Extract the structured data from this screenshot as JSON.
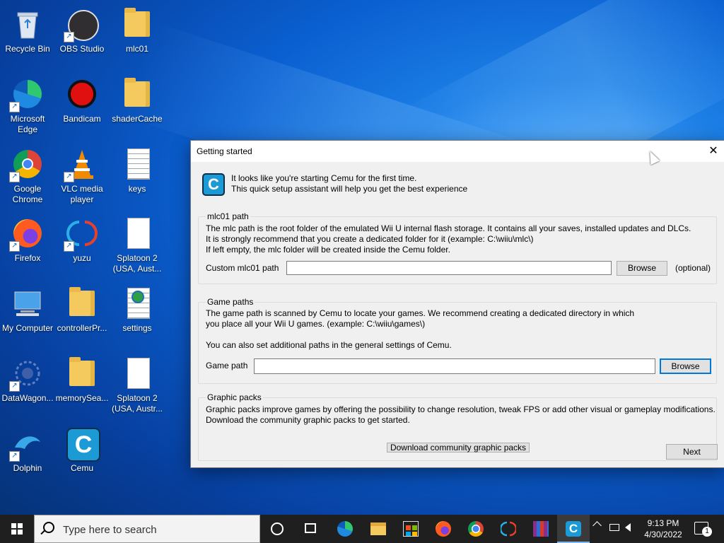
{
  "desktop": {
    "icons": [
      {
        "label": "Recycle Bin"
      },
      {
        "label": "OBS Studio"
      },
      {
        "label": "mlc01"
      },
      {
        "label": "Microsoft Edge"
      },
      {
        "label": "Bandicam"
      },
      {
        "label": "shaderCache"
      },
      {
        "label": "Google Chrome"
      },
      {
        "label": "VLC media player"
      },
      {
        "label": "keys"
      },
      {
        "label": "Firefox"
      },
      {
        "label": "yuzu"
      },
      {
        "label": "Splatoon 2 (USA, Aust..."
      },
      {
        "label": "My Computer"
      },
      {
        "label": "controllerPr..."
      },
      {
        "label": "settings"
      },
      {
        "label": "DataWagon..."
      },
      {
        "label": "memorySea..."
      },
      {
        "label": "Splatoon 2 (USA, Austr..."
      },
      {
        "label": "Dolphin"
      },
      {
        "label": "Cemu"
      }
    ]
  },
  "dialog": {
    "title": "Getting started",
    "close_glyph": "✕",
    "logo_letter": "C",
    "intro_line1": "It looks like you're starting Cemu for the first time.",
    "intro_line2": "This quick setup assistant will help you get the best experience",
    "mlc": {
      "heading": "mlc01 path",
      "line1": "The mlc path is the root folder of the emulated Wii U internal flash storage. It contains all your saves, installed updates and DLCs.",
      "line2": "It is strongly recommend that you create a dedicated folder for it (example: C:\\wiiu\\mlc\\)",
      "line3": "If left empty, the mlc folder will be created inside the Cemu folder.",
      "field_label": "Custom mlc01 path",
      "field_value": "",
      "browse_label": "Browse",
      "optional_label": "(optional)"
    },
    "game": {
      "heading": "Game paths",
      "line1": "The game path is scanned by Cemu to locate your games. We recommend creating a dedicated directory in which",
      "line2": "you place all your Wii U games. (example: C:\\wiiu\\games\\)",
      "line3": "You can also set additional paths in the general settings of Cemu.",
      "field_label": "Game path",
      "field_value": "",
      "browse_label": "Browse"
    },
    "graphics": {
      "heading": "Graphic packs",
      "line1": "Graphic packs improve games by offering the possibility to change resolution, tweak FPS or add other visual or gameplay modifications.",
      "line2": "Download the community graphic packs to get started.",
      "download_label": "Download community graphic packs"
    },
    "next_label": "Next"
  },
  "taskbar": {
    "search_placeholder": "Type here to search",
    "time": "9:13 PM",
    "date": "4/30/2022",
    "notification_count": "1",
    "icons": [
      "task-view-icon",
      "edge-icon",
      "file-explorer-icon",
      "store-icon",
      "firefox-icon",
      "chrome-icon",
      "yuzu-icon",
      "winrar-icon",
      "cemu-icon"
    ]
  },
  "colors": {
    "cemu_blue": "#1b9ad6",
    "taskbar": "#1f1f1f",
    "focus_border": "#0078d7"
  }
}
